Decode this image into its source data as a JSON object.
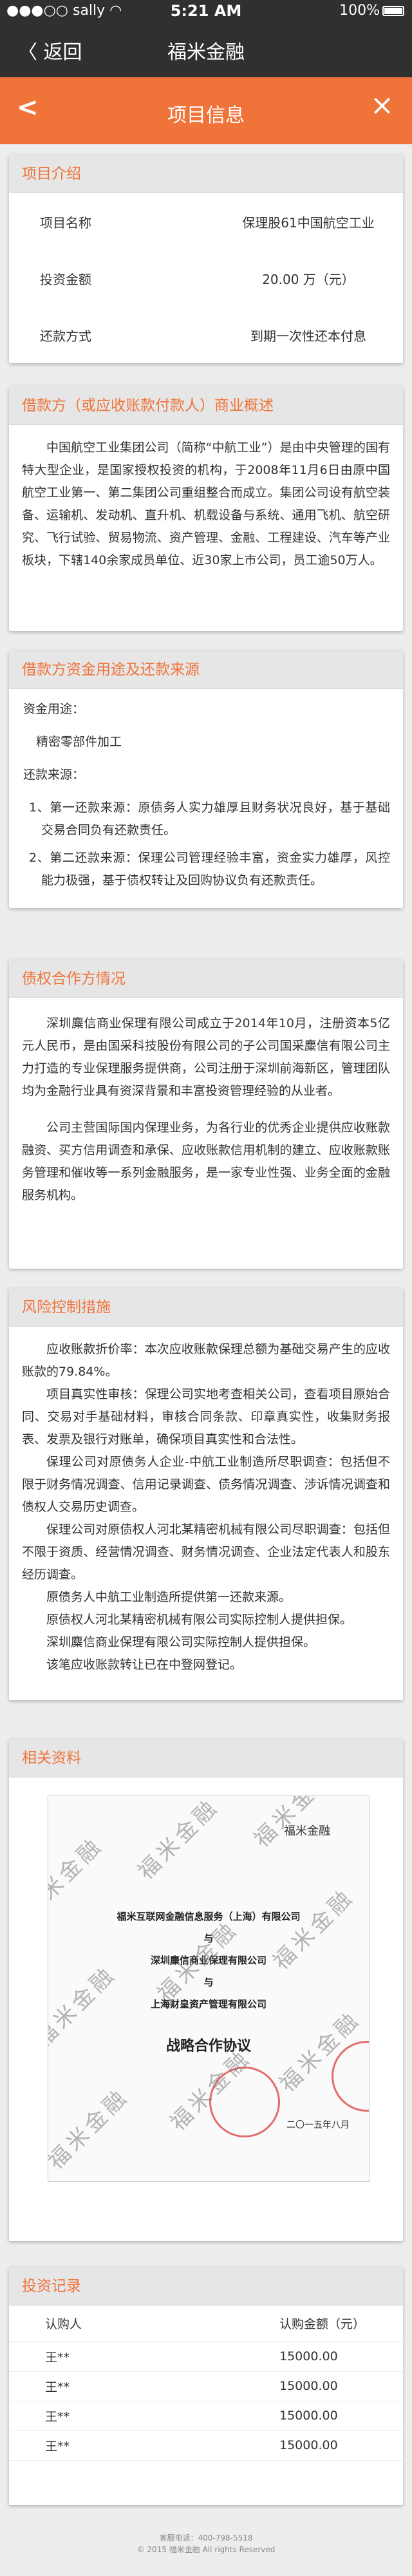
{
  "status_bar": {
    "carrier": "sally",
    "time": "5:21 AM",
    "battery": "100%"
  },
  "navbar": {
    "back_label": "返回",
    "title": "福米金融"
  },
  "subnav": {
    "title": "项目信息"
  },
  "project_intro": {
    "heading": "项目介绍",
    "rows": [
      {
        "label": "项目名称",
        "value": "保理股61中国航空工业"
      },
      {
        "label": "投资金额",
        "value": "20.00 万（元）"
      },
      {
        "label": "还款方式",
        "value": "到期一次性还本付息"
      }
    ]
  },
  "business_overview": {
    "heading": "借款方（或应收账款付款人）商业概述",
    "text": "中国航空工业集团公司（简称“中航工业”）是由中央管理的国有特大型企业，是国家授权投资的机构，于2008年11月6日由原中国航空工业第一、第二集团公司重组整合而成立。集团公司设有航空装备、运输机、发动机、直升机、机载设备与系统、通用飞机、航空研究、飞行试验、贸易物流、资产管理、金融、工程建设、汽车等产业板块，下辖140余家成员单位、近30家上市公司，员工逾50万人。"
  },
  "funds_usage": {
    "heading": "借款方资金用途及还款来源",
    "usage_label": "资金用途：",
    "usage_value": "精密零部件加工",
    "repayment_label": "还款来源：",
    "repayment_items": [
      "1、第一还款来源：原债务人实力雄厚且财务状况良好，基于基础交易合同负有还款责任。",
      "2、第二还款来源：保理公司管理经验丰富，资金实力雄厚，风控能力极强，基于债权转让及回购协议负有还款责任。"
    ]
  },
  "guarantee": {
    "heading": "债权合作方情况",
    "paragraphs": [
      "深圳麋信商业保理有限公司成立于2014年10月，注册资本5亿元人民币，是由国采科技股份有限公司的子公司国采麋信有限公司主力打造的专业保理服务提供商，公司注册于深圳前海新区，管理团队均为金融行业具有资深背景和丰富投资管理经验的从业者。",
      "公司主营国际国内保理业务，为各行业的优秀企业提供应收账款融资、买方信用调查和承保、应收账款信用机制的建立、应收账款账务管理和催收等一系列金融服务，是一家专业性强、业务全面的金融服务机构。"
    ]
  },
  "risk_control": {
    "heading": "风险控制措施",
    "paragraphs": [
      "应收账款折价率：本次应收账款保理总额为基础交易产生的应收账款的79.84%。",
      "项目真实性审核：保理公司实地考查相关公司，查看项目原始合同、交易对手基础材料，审核合同条款、印章真实性，收集财务报表、发票及银行对账单，确保项目真实性和合法性。",
      "保理公司对原债务人企业-中航工业制造所尽职调查：包括但不限于财务情况调查、信用记录调查、债务情况调查、涉诉情况调查和债权人交易历史调查。",
      "保理公司对原债权人河北某精密机械有限公司尽职调查：包括但不限于资质、经营情况调查、财务情况调查、企业法定代表人和股东经历调查。",
      "原债务人中航工业制造所提供第一还款来源。",
      "原债权人河北某精密机械有限公司实际控制人提供担保。",
      "深圳麋信商业保理有限公司实际控制人提供担保。",
      "该笔应收账款转让已在中登网登记。"
    ]
  },
  "documents": {
    "heading": "相关资料",
    "scan": {
      "logo": "福米金融",
      "party_lines": [
        "福米互联网金融信息服务（上海）有限公司",
        "与",
        "深圳麋信商业保理有限公司",
        "与",
        "上海财皇资产管理有限公司"
      ],
      "doc_title": "战略合作协议",
      "date": "二〇一五年八月",
      "watermark": "福米金融"
    }
  },
  "investment_records": {
    "heading": "投资记录",
    "columns": [
      "认购人",
      "认购金额（元）"
    ],
    "rows": [
      [
        "王**",
        "15000.00"
      ],
      [
        "王**",
        "15000.00"
      ],
      [
        "王**",
        "15000.00"
      ],
      [
        "王**",
        "15000.00"
      ]
    ]
  },
  "footer": {
    "hotline": "客服电话：400-798-5518",
    "copyright": "© 2015 福米金融 All rights Reserved"
  },
  "colors": {
    "accent": "#f0733a",
    "bar": "#303030",
    "background": "#ededed"
  }
}
